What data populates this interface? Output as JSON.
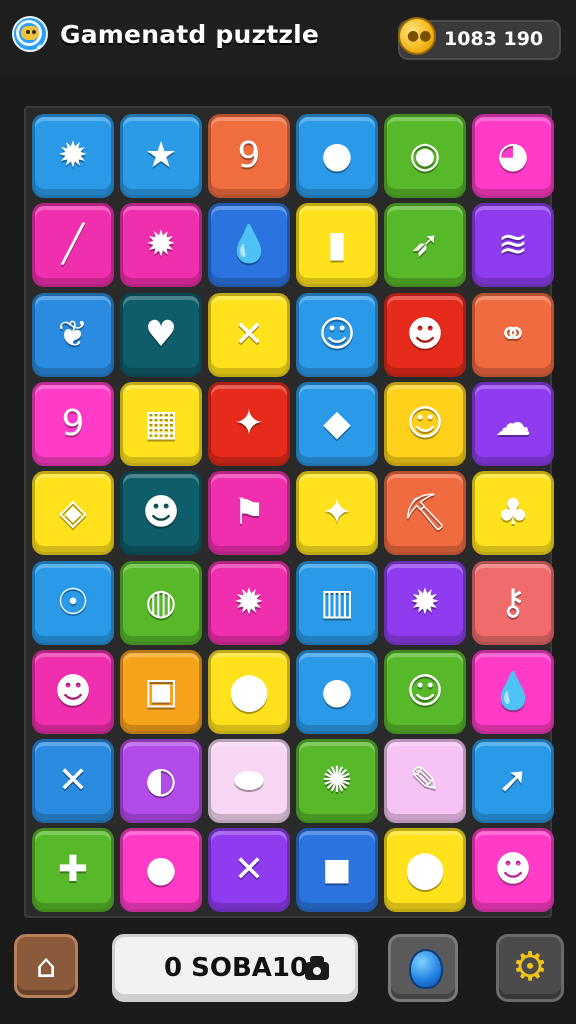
{
  "header": {
    "title": "Gamenatd puztzle",
    "coins": "1083 190"
  },
  "footer": {
    "score": "0 SOBA10"
  },
  "colors": {
    "tile_palette": {
      "blue": "#2c9be6",
      "orange": "#f06b3f",
      "green": "#57b82a",
      "pink": "#ef2fae",
      "magenta": "#ff3bc7",
      "yellow": "#ffe21b",
      "purple": "#8f3cf0",
      "teal": "#0e5d6a",
      "red": "#e62a1b",
      "white": "#f6d6f2"
    }
  },
  "board": {
    "rows": [
      [
        {
          "color": "#2a9ae8",
          "icon": "sun-icon"
        },
        {
          "color": "#2b9be7",
          "icon": "star-icon"
        },
        {
          "color": "#f06d3f",
          "icon": "nine-icon"
        },
        {
          "color": "#2a9ae8",
          "icon": "pumpkin-icon"
        },
        {
          "color": "#57b82a",
          "icon": "orb-icon"
        },
        {
          "color": "#ff3bc7",
          "icon": "chick-icon"
        }
      ],
      [
        {
          "color": "#ef2fae",
          "icon": "wand-icon"
        },
        {
          "color": "#ef2fae",
          "icon": "sun-icon"
        },
        {
          "color": "#2b74e0",
          "icon": "drop-icon"
        },
        {
          "color": "#ffe21b",
          "icon": "jar-icon"
        },
        {
          "color": "#57b82a",
          "icon": "carrot-icon"
        },
        {
          "color": "#8f3cf0",
          "icon": "bacon-icon"
        }
      ],
      [
        {
          "color": "#2a8be0",
          "icon": "leaf-icon"
        },
        {
          "color": "#0e5d6a",
          "icon": "heart-icon"
        },
        {
          "color": "#ffe21b",
          "icon": "cross-icon"
        },
        {
          "color": "#2a9ae8",
          "icon": "bug-icon"
        },
        {
          "color": "#e62a1b",
          "icon": "cat-face-icon"
        },
        {
          "color": "#f06b3f",
          "icon": "barbell-icon"
        }
      ],
      [
        {
          "color": "#ff3bc7",
          "icon": "nine-icon"
        },
        {
          "color": "#ffe21b",
          "icon": "barrel-icon"
        },
        {
          "color": "#e62a1b",
          "icon": "candy-icon"
        },
        {
          "color": "#2a9ae8",
          "icon": "slime-icon"
        },
        {
          "color": "#ffd11b",
          "icon": "bug-icon"
        },
        {
          "color": "#8f3cf0",
          "icon": "ghost-icon"
        }
      ],
      [
        {
          "color": "#ffe21b",
          "icon": "gem-icon"
        },
        {
          "color": "#0e5d6a",
          "icon": "cat-face-icon"
        },
        {
          "color": "#ef2fae",
          "icon": "flag-icon"
        },
        {
          "color": "#ffe21b",
          "icon": "candy-icon"
        },
        {
          "color": "#f06b3f",
          "icon": "pickaxe-icon"
        },
        {
          "color": "#ffe21b",
          "icon": "pineapple-icon"
        }
      ],
      [
        {
          "color": "#2a9ae8",
          "icon": "ninja-icon"
        },
        {
          "color": "#57b82a",
          "icon": "egg-icon"
        },
        {
          "color": "#ef2fae",
          "icon": "sun-icon"
        },
        {
          "color": "#2a9ae8",
          "icon": "cage-icon"
        },
        {
          "color": "#8f3cf0",
          "icon": "sun-icon"
        },
        {
          "color": "#f06b6b",
          "icon": "key-icon"
        }
      ],
      [
        {
          "color": "#ef2fae",
          "icon": "cat-face-icon"
        },
        {
          "color": "#f7a21b",
          "icon": "robot-icon"
        },
        {
          "color": "#ffe21b",
          "icon": "rock-icon"
        },
        {
          "color": "#2a9ae8",
          "icon": "pumpkin-icon"
        },
        {
          "color": "#57b82a",
          "icon": "frog-icon"
        },
        {
          "color": "#ff3bc7",
          "icon": "drop-icon"
        }
      ],
      [
        {
          "color": "#2a8be0",
          "icon": "cross-icon"
        },
        {
          "color": "#b34be8",
          "icon": "shield-icon"
        },
        {
          "color": "#f6d6f2",
          "icon": "capsule-icon"
        },
        {
          "color": "#57b82a",
          "icon": "bee-icon"
        },
        {
          "color": "#f6c3f5",
          "icon": "pencil-icon"
        },
        {
          "color": "#2a9ae8",
          "icon": "arrow-icon"
        }
      ],
      [
        {
          "color": "#57b82a",
          "icon": "bone-icon"
        },
        {
          "color": "#ff3bc7",
          "icon": "orange-icon"
        },
        {
          "color": "#8f3cf0",
          "icon": "x-icon"
        },
        {
          "color": "#2b74e0",
          "icon": "box-icon"
        },
        {
          "color": "#ffe21b",
          "icon": "rock-icon"
        },
        {
          "color": "#ff3bc7",
          "icon": "cat-face-icon"
        }
      ]
    ]
  }
}
